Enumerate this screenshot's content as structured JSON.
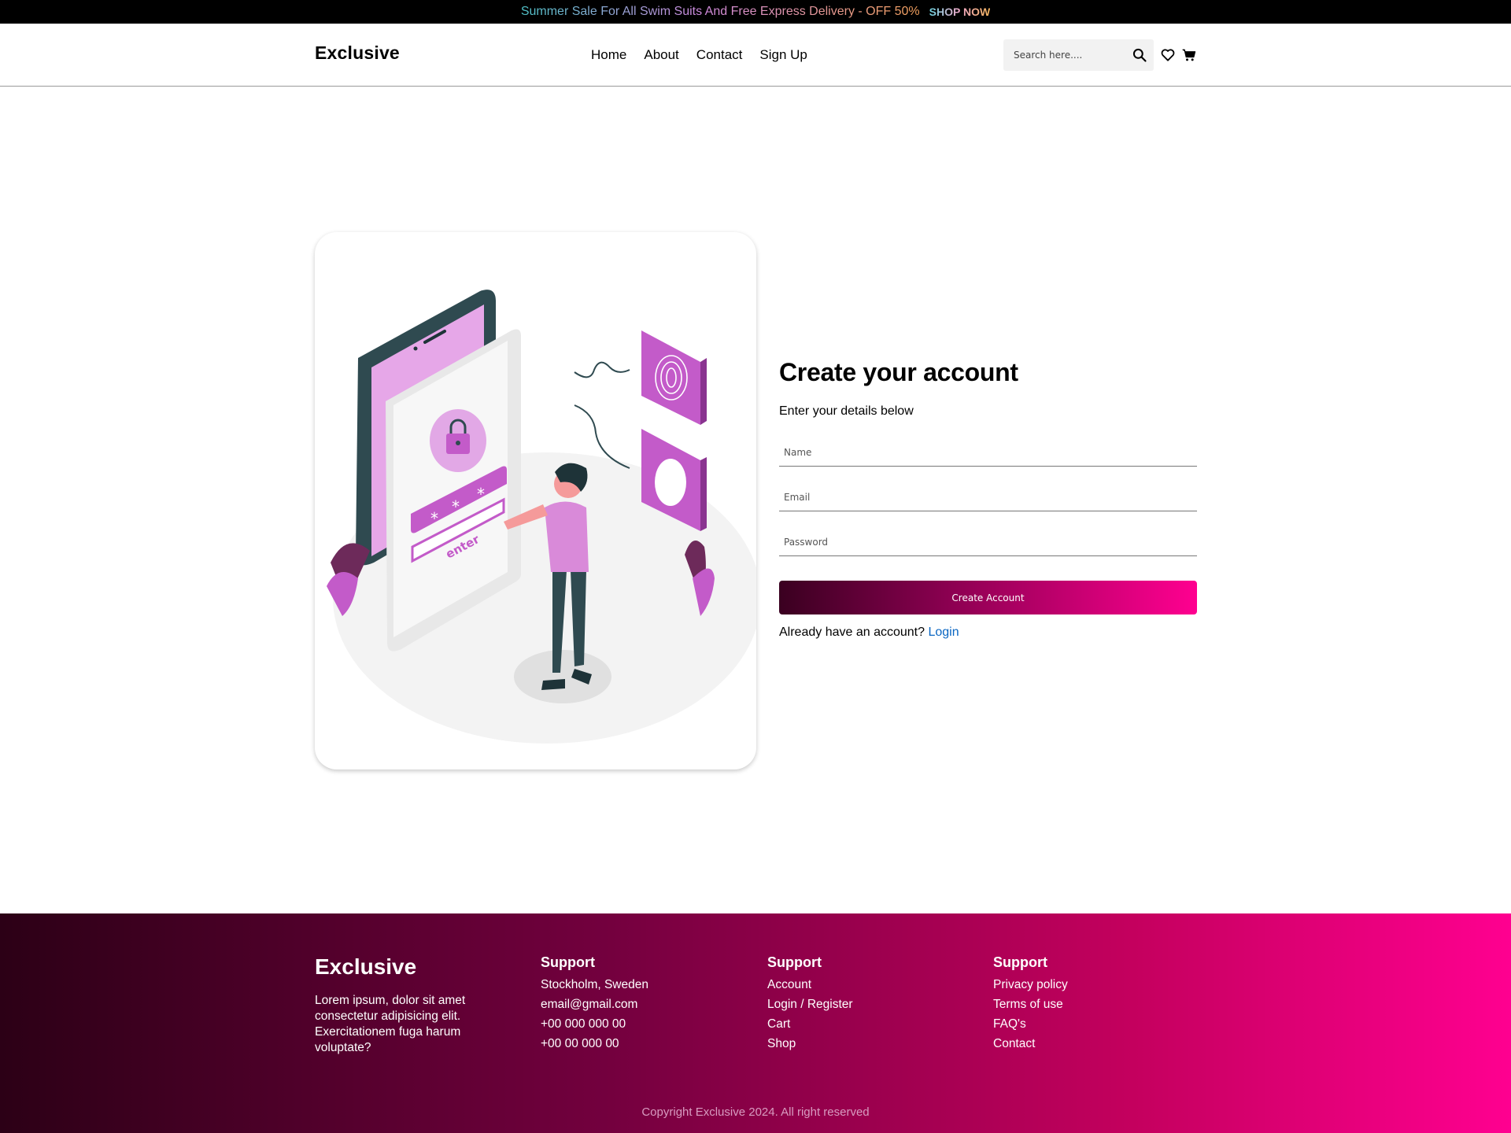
{
  "promo": {
    "text": "Summer Sale For All Swim Suits And Free Express Delivery - OFF 50%",
    "link": "SHOP NOW"
  },
  "header": {
    "logo": "Exclusive",
    "nav": [
      "Home",
      "About",
      "Contact",
      "Sign Up"
    ],
    "search_placeholder": "Search here....",
    "icons": [
      "search-icon",
      "heart-icon",
      "cart-icon"
    ]
  },
  "illustration": {
    "lock_button_text": "enter"
  },
  "form": {
    "title": "Create your account",
    "subtitle": "Enter your details below",
    "name_placeholder": "Name",
    "email_placeholder": "Email",
    "password_placeholder": "Password",
    "submit_label": "Create Account",
    "login_prompt": "Already have an account?",
    "login_link": "Login"
  },
  "footer": {
    "logo": "Exclusive",
    "description": "Lorem ipsum, dolor sit amet consectetur adipisicing elit. Exercitationem fuga harum voluptate?",
    "columns": [
      {
        "title": "Support",
        "items": [
          "Stockholm, Sweden",
          "email@gmail.com",
          "+00 000 000 00",
          "+00 00 000 00"
        ]
      },
      {
        "title": "Support",
        "items": [
          "Account",
          "Login / Register",
          "Cart",
          "Shop"
        ]
      },
      {
        "title": "Support",
        "items": [
          "Privacy policy",
          "Terms of use",
          "FAQ's",
          "Contact"
        ]
      }
    ],
    "copyright": "Copyright Exclusive 2024. All right reserved"
  },
  "colors": {
    "accent": "#ff0090",
    "accent_dark": "#3a0020",
    "link": "#0a66c2",
    "illustration_purple": "#c35bc9"
  }
}
